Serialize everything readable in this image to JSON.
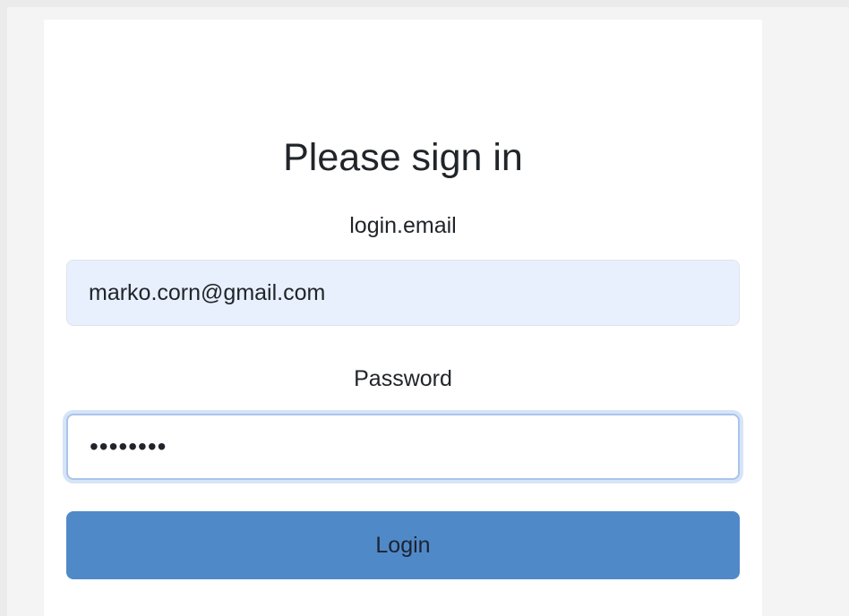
{
  "login": {
    "title": "Please sign in",
    "email_label": "login.email",
    "email_value": "marko.corn@gmail.com",
    "password_label": "Password",
    "password_value": "••••••••",
    "login_button": "Login"
  },
  "colors": {
    "button": "#5089c8",
    "email_autofill_bg": "#e8f0fe",
    "focus_ring": "#d6e4f7"
  }
}
